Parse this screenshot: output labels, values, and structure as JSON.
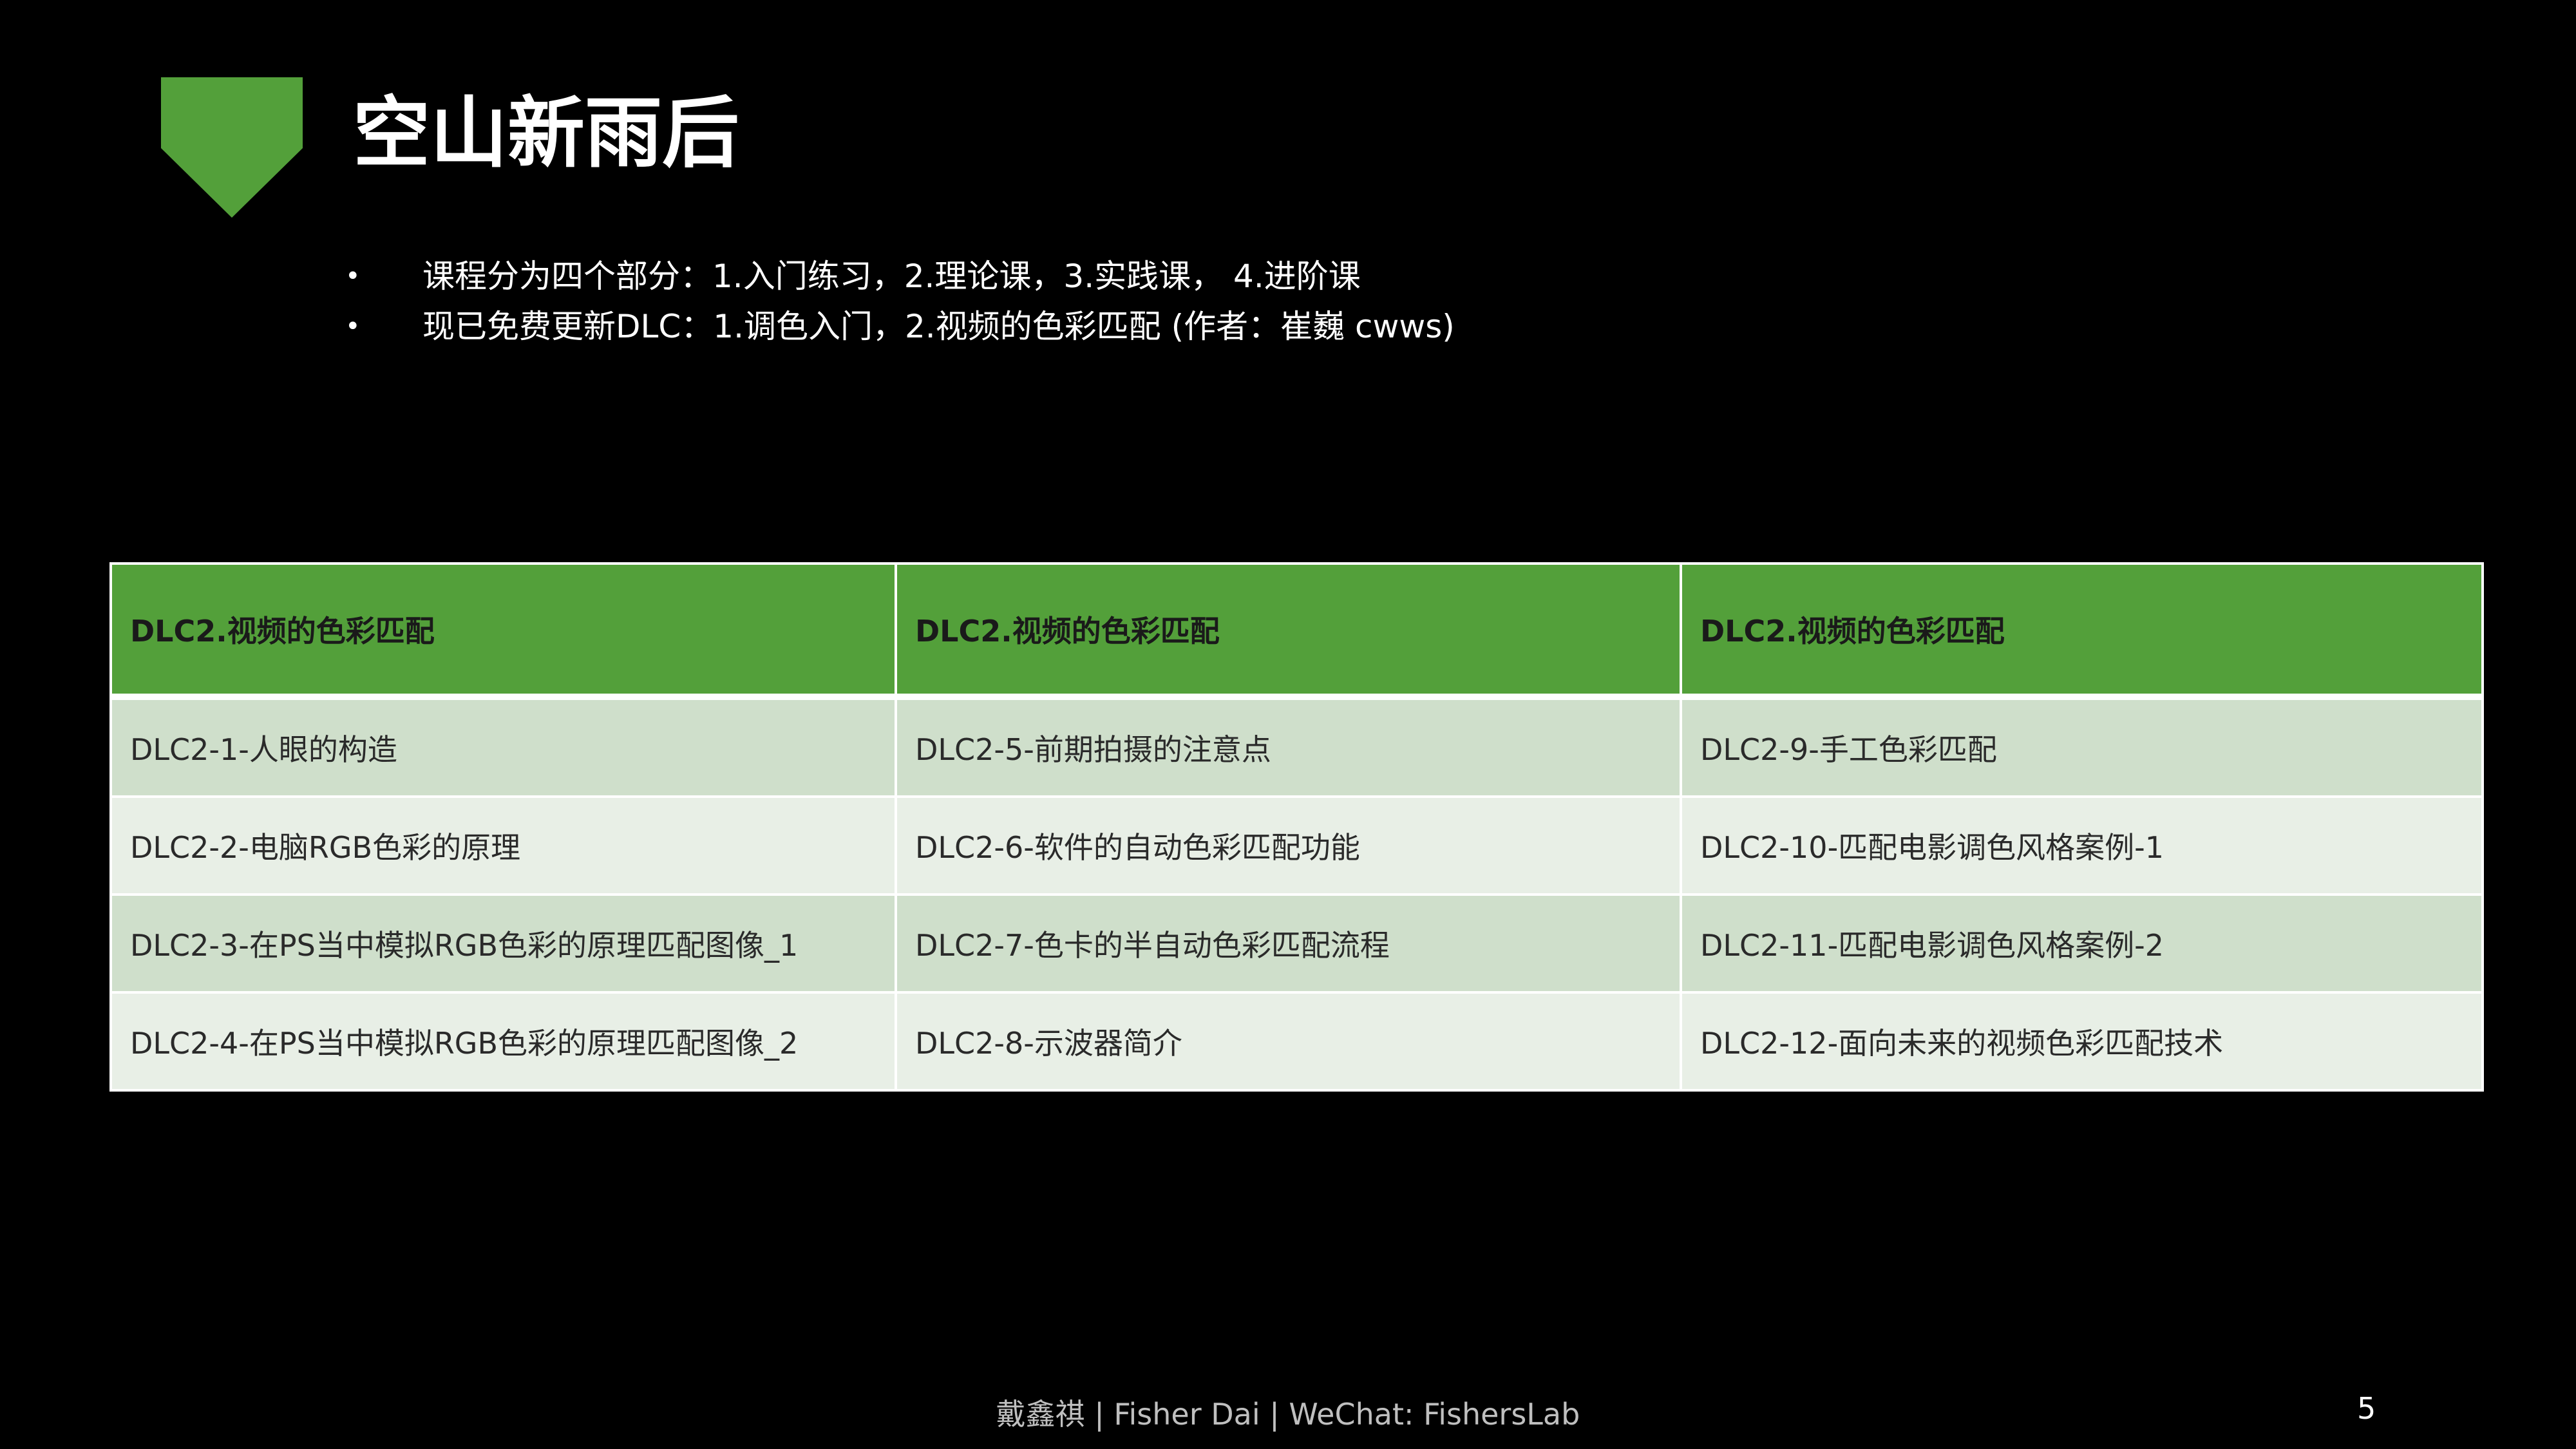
{
  "slide": {
    "title": "空山新雨后",
    "bullets": [
      "课程分为四个部分：1.入门练习，2.理论课，3.实践课， 4.进阶课",
      "现已免费更新DLC：1.调色入门，2.视频的色彩匹配 (作者：崔巍 cwws)"
    ],
    "footer": "戴鑫祺 | Fisher Dai | WeChat: FishersLab",
    "page_number": "5"
  },
  "table": {
    "headers": [
      "DLC2.视频的色彩匹配",
      "DLC2.视频的色彩匹配",
      "DLC2.视频的色彩匹配"
    ],
    "rows": [
      [
        "DLC2-1-人眼的构造",
        "DLC2-5-前期拍摄的注意点",
        "DLC2-9-手工色彩匹配"
      ],
      [
        "DLC2-2-电脑RGB色彩的原理",
        "DLC2-6-软件的自动色彩匹配功能",
        "DLC2-10-匹配电影调色风格案例-1"
      ],
      [
        "DLC2-3-在PS当中模拟RGB色彩的原理匹配图像_1",
        "DLC2-7-色卡的半自动色彩匹配流程",
        "DLC2-11-匹配电影调色风格案例-2"
      ],
      [
        "DLC2-4-在PS当中模拟RGB色彩的原理匹配图像_2",
        "DLC2-8-示波器简介",
        "DLC2-12-面向未来的视频色彩匹配技术"
      ]
    ]
  },
  "colors": {
    "background": "#000000",
    "accent": "#53a03a",
    "row_odd": "#cfdfcb",
    "row_even": "#e8efe6"
  },
  "icons": {
    "badge": "chevron-pentagon-icon",
    "bullet": "bullet-dot-icon"
  }
}
